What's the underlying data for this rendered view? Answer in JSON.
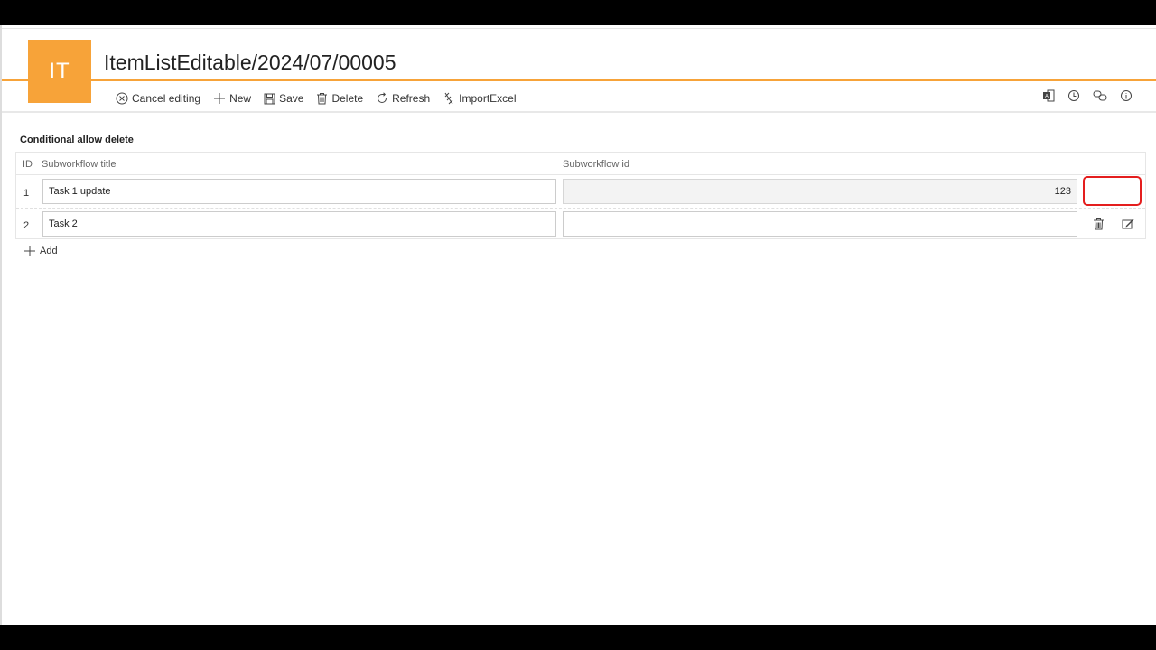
{
  "header": {
    "logo_text": "IT",
    "title": "ItemListEditable/2024/07/00005",
    "accent_color": "#f7a339"
  },
  "toolbar": {
    "cancel_label": "Cancel editing",
    "new_label": "New",
    "save_label": "Save",
    "delete_label": "Delete",
    "refresh_label": "Refresh",
    "import_label": "ImportExcel",
    "right_icons": [
      "access-icon",
      "history-icon",
      "link-icon",
      "info-icon"
    ]
  },
  "section": {
    "title": "Conditional allow delete"
  },
  "table": {
    "columns": [
      "ID",
      "Subworkflow title",
      "Subworkflow id"
    ],
    "rows": [
      {
        "id": "1",
        "title": "Task 1 update",
        "subworkflow_id": "123"
      },
      {
        "id": "2",
        "title": "Task 2",
        "subworkflow_id": ""
      }
    ],
    "highlight_color": "#e41e1e"
  },
  "add_label": "Add"
}
